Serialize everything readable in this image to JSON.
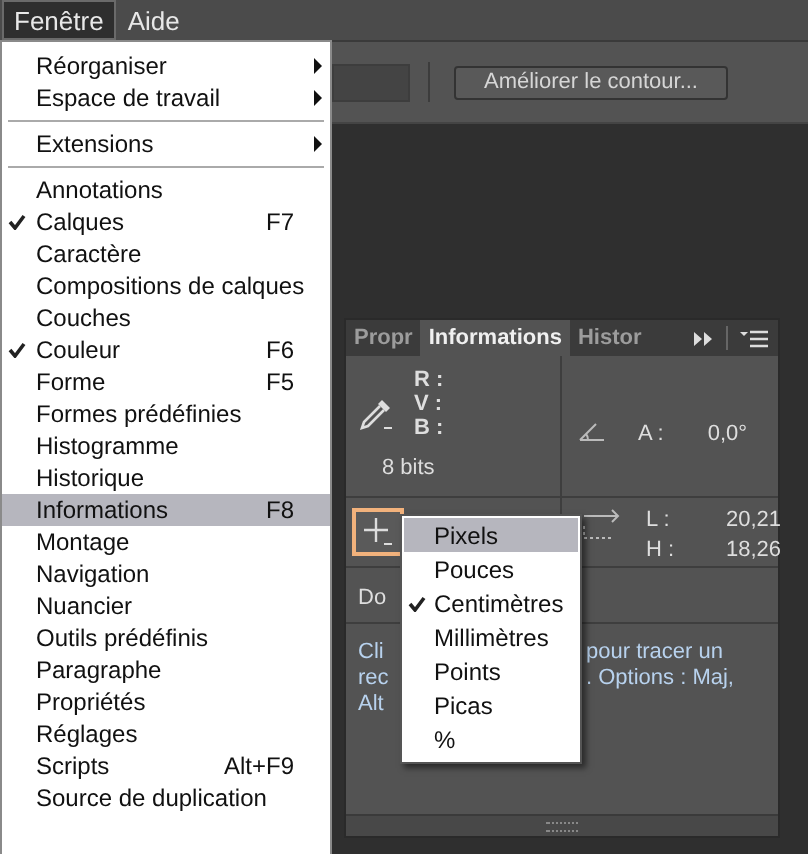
{
  "menubar": [
    {
      "label": "Fenêtre",
      "selected": true
    },
    {
      "label": "Aide",
      "selected": false
    }
  ],
  "options_bar": {
    "button": "Améliorer le contour..."
  },
  "menu": {
    "items": [
      {
        "kind": "submenu",
        "label": "Réorganiser",
        "checked": false,
        "selected": false
      },
      {
        "kind": "submenu",
        "label": "Espace de travail",
        "checked": false,
        "selected": false
      },
      {
        "kind": "separator"
      },
      {
        "kind": "submenu",
        "label": "Extensions",
        "checked": false,
        "selected": false
      },
      {
        "kind": "separator"
      },
      {
        "kind": "item",
        "label": "Annotations",
        "checked": false,
        "selected": false
      },
      {
        "kind": "item",
        "label": "Calques",
        "shortcut": "F7",
        "checked": true,
        "selected": false
      },
      {
        "kind": "item",
        "label": "Caractère",
        "checked": false,
        "selected": false
      },
      {
        "kind": "item",
        "label": "Compositions de calques",
        "checked": false,
        "selected": false
      },
      {
        "kind": "item",
        "label": "Couches",
        "checked": false,
        "selected": false
      },
      {
        "kind": "item",
        "label": "Couleur",
        "shortcut": "F6",
        "checked": true,
        "selected": false
      },
      {
        "kind": "item",
        "label": "Forme",
        "shortcut": "F5",
        "checked": false,
        "selected": false
      },
      {
        "kind": "item",
        "label": "Formes prédéfinies",
        "checked": false,
        "selected": false
      },
      {
        "kind": "item",
        "label": "Histogramme",
        "checked": false,
        "selected": false
      },
      {
        "kind": "item",
        "label": "Historique",
        "checked": false,
        "selected": false
      },
      {
        "kind": "item",
        "label": "Informations",
        "shortcut": "F8",
        "checked": false,
        "selected": true
      },
      {
        "kind": "item",
        "label": "Montage",
        "checked": false,
        "selected": false
      },
      {
        "kind": "item",
        "label": "Navigation",
        "checked": false,
        "selected": false
      },
      {
        "kind": "item",
        "label": "Nuancier",
        "checked": false,
        "selected": false
      },
      {
        "kind": "item",
        "label": "Outils prédéfinis",
        "checked": false,
        "selected": false
      },
      {
        "kind": "item",
        "label": "Paragraphe",
        "checked": false,
        "selected": false
      },
      {
        "kind": "item",
        "label": "Propriétés",
        "checked": false,
        "selected": false
      },
      {
        "kind": "item",
        "label": "Réglages",
        "checked": false,
        "selected": false
      },
      {
        "kind": "item",
        "label": "Scripts",
        "shortcut": "Alt+F9",
        "checked": false,
        "selected": false
      },
      {
        "kind": "item",
        "label": "Source de duplication",
        "checked": false,
        "selected": false
      }
    ]
  },
  "panel": {
    "tabs": [
      {
        "label": "Propr",
        "selected": false
      },
      {
        "label": "Informations",
        "selected": true
      },
      {
        "label": "Histor",
        "selected": false
      }
    ],
    "color_labels": [
      "R :",
      "V :",
      "B :"
    ],
    "bit_depth": "8 bits",
    "angle_label": "A :",
    "angle_value": "0,0°",
    "position_picker": {
      "selected": true
    },
    "size": [
      {
        "label": "L :",
        "value": "20,21"
      },
      {
        "label": "H :",
        "value": "18,26"
      }
    ],
    "doc_label": "Do",
    "hint_left": [
      "Cli",
      "rec",
      "Alt"
    ],
    "hint_right": [
      "pour tracer un",
      ". Options : Maj,"
    ]
  },
  "units_menu": [
    {
      "label": "Pixels",
      "checked": false,
      "selected": true
    },
    {
      "label": "Pouces",
      "checked": false,
      "selected": false
    },
    {
      "label": "Centimètres",
      "checked": true,
      "selected": false
    },
    {
      "label": "Millimètres",
      "checked": false,
      "selected": false
    },
    {
      "label": "Points",
      "checked": false,
      "selected": false
    },
    {
      "label": "Picas",
      "checked": false,
      "selected": false
    },
    {
      "label": "%",
      "checked": false,
      "selected": false
    }
  ]
}
